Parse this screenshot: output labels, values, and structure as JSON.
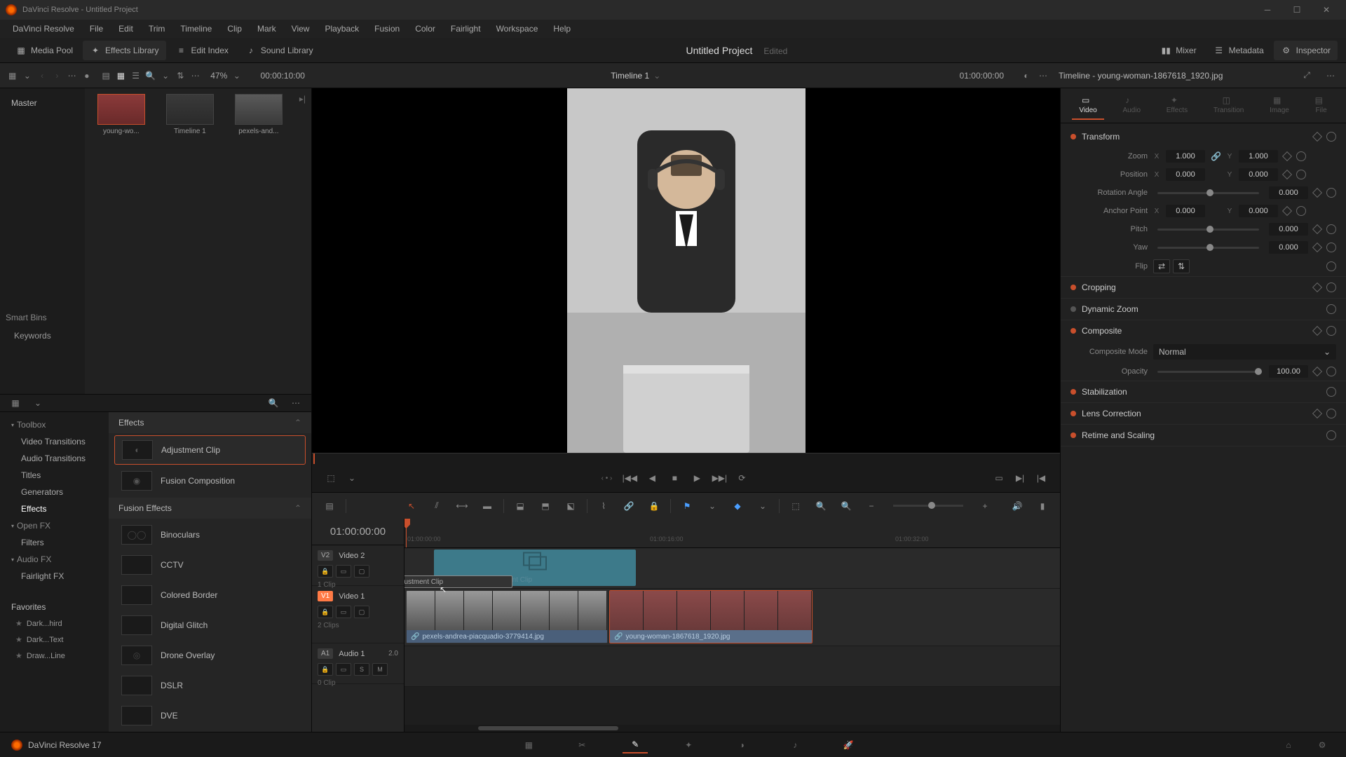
{
  "titlebar": {
    "title": "DaVinci Resolve - Untitled Project"
  },
  "menubar": [
    "DaVinci Resolve",
    "File",
    "Edit",
    "Trim",
    "Timeline",
    "Clip",
    "Mark",
    "View",
    "Playback",
    "Fusion",
    "Color",
    "Fairlight",
    "Workspace",
    "Help"
  ],
  "top_toolbar": {
    "media_pool": "Media Pool",
    "effects_library": "Effects Library",
    "edit_index": "Edit Index",
    "sound_library": "Sound Library",
    "project_name": "Untitled Project",
    "edited": "Edited",
    "mixer": "Mixer",
    "metadata": "Metadata",
    "inspector": "Inspector"
  },
  "sec_toolbar": {
    "zoom_pct": "47%",
    "src_timecode": "00:00:10:00",
    "timeline_name": "Timeline 1",
    "tl_timecode": "01:00:00:00",
    "inspector_title": "Timeline - young-woman-1867618_1920.jpg"
  },
  "media_pool": {
    "master": "Master",
    "smart_bins_header": "Smart Bins",
    "smart_bins": [
      "Keywords"
    ],
    "clips": [
      {
        "label": "young-wo..."
      },
      {
        "label": "Timeline 1"
      },
      {
        "label": "pexels-and..."
      }
    ]
  },
  "fx_sidebar": {
    "toolbox": "Toolbox",
    "items": [
      "Video Transitions",
      "Audio Transitions",
      "Titles",
      "Generators",
      "Effects"
    ],
    "openfx": "Open FX",
    "openfx_items": [
      "Filters"
    ],
    "audiofx": "Audio FX",
    "audiofx_items": [
      "Fairlight FX"
    ],
    "favorites": "Favorites",
    "fav_items": [
      "Dark...hird",
      "Dark...Text",
      "Draw...Line"
    ]
  },
  "fx_list": {
    "effects_header": "Effects",
    "fusion_header": "Fusion Effects",
    "items": [
      {
        "label": "Adjustment Clip",
        "selected": true
      },
      {
        "label": "Fusion Composition",
        "selected": false
      }
    ],
    "fusion_items": [
      {
        "label": "Binoculars"
      },
      {
        "label": "CCTV"
      },
      {
        "label": "Colored Border"
      },
      {
        "label": "Digital Glitch"
      },
      {
        "label": "Drone Overlay"
      },
      {
        "label": "DSLR"
      },
      {
        "label": "DVE"
      }
    ]
  },
  "inspector": {
    "tabs": [
      "Video",
      "Audio",
      "Effects",
      "Transition",
      "Image",
      "File"
    ],
    "transform": {
      "title": "Transform",
      "zoom": "Zoom",
      "zoom_x": "1.000",
      "zoom_y": "1.000",
      "position": "Position",
      "pos_x": "0.000",
      "pos_y": "0.000",
      "rotation": "Rotation Angle",
      "rotation_val": "0.000",
      "anchor": "Anchor Point",
      "anchor_x": "0.000",
      "anchor_y": "0.000",
      "pitch": "Pitch",
      "pitch_val": "0.000",
      "yaw": "Yaw",
      "yaw_val": "0.000",
      "flip": "Flip"
    },
    "cropping": "Cropping",
    "dynamic_zoom": "Dynamic Zoom",
    "composite": {
      "title": "Composite",
      "mode_label": "Composite Mode",
      "mode_val": "Normal",
      "opacity_label": "Opacity",
      "opacity_val": "100.00"
    },
    "stabilization": "Stabilization",
    "lens_correction": "Lens Correction",
    "retime": "Retime and Scaling"
  },
  "timeline": {
    "big_tc": "01:00:00:00",
    "tracks": {
      "v2": {
        "badge": "V2",
        "name": "Video 2",
        "meta": "1 Clip"
      },
      "v1": {
        "badge": "V1",
        "name": "Video 1",
        "meta": "2 Clips"
      },
      "a1": {
        "badge": "A1",
        "name": "Audio 1",
        "meta": "0 Clip",
        "gain": "2.0"
      }
    },
    "drag_label": "Adjustment Clip",
    "adj_label": "Adjustment Clip",
    "clip1_name": "pexels-andrea-piacquadio-3779414.jpg",
    "clip2_name": "young-woman-1867618_1920.jpg",
    "ruler_ticks": [
      "01:00:00:00",
      "01:00:16:00",
      "01:00:32:00"
    ]
  },
  "bottom": {
    "version": "DaVinci Resolve 17"
  }
}
